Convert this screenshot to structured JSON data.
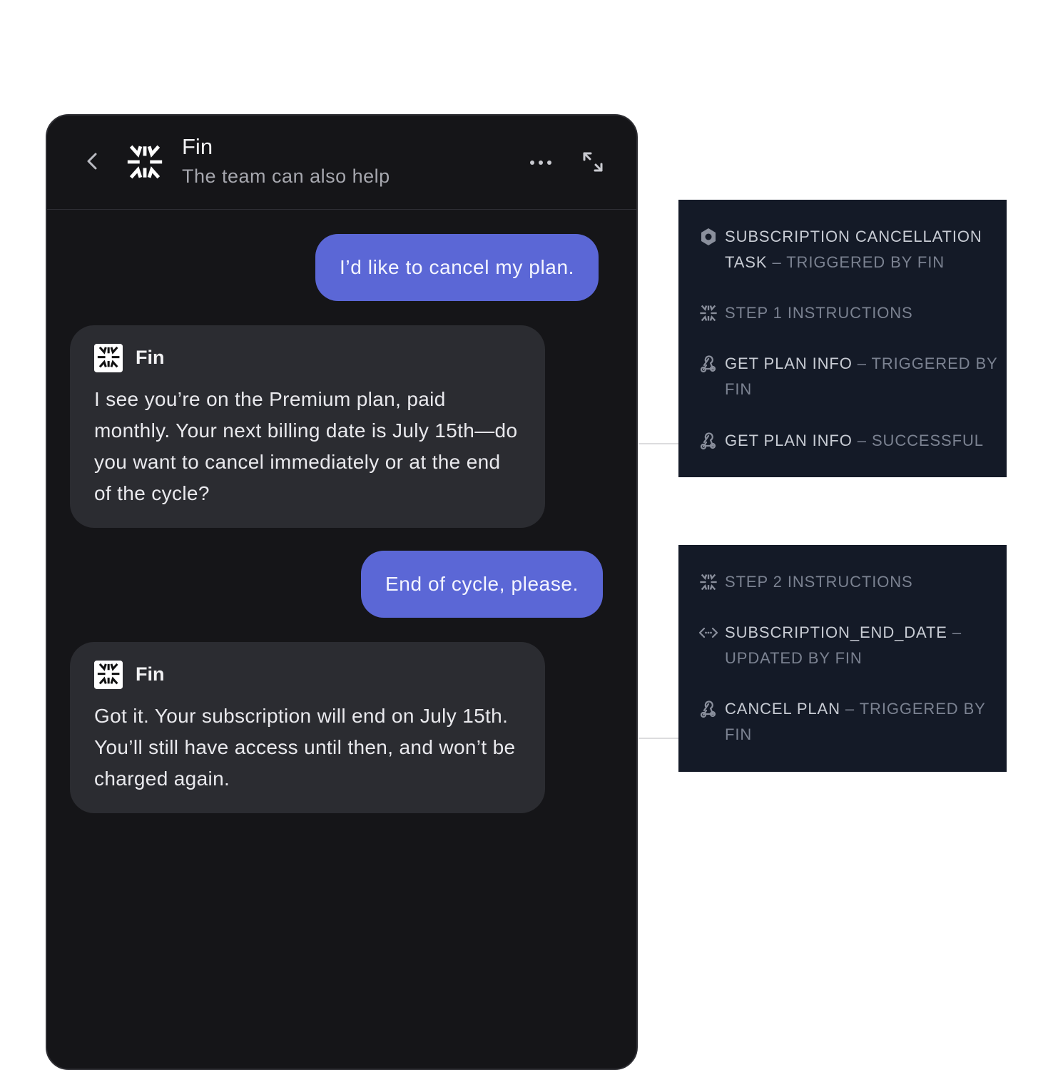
{
  "header": {
    "title": "Fin",
    "subtitle": "The team can also help",
    "back_icon": "chevron-left-icon",
    "more_icon": "more-horizontal-icon",
    "expand_icon": "expand-icon"
  },
  "messages": [
    {
      "role": "user",
      "text": "I’d like to cancel my plan."
    },
    {
      "role": "bot",
      "name": "Fin",
      "text": "I see you’re on the Premium plan, paid monthly. Your next billing date is July 15th—do you want to cancel immediately or at the end of the cycle?"
    },
    {
      "role": "user",
      "text": "End of cycle, please."
    },
    {
      "role": "bot",
      "name": "Fin",
      "text": "Got it. Your subscription will end on July 15th. You’ll still have access until then, and won’t be charged again."
    }
  ],
  "panels": [
    {
      "items": [
        {
          "icon": "hexagon-icon",
          "primary": "Subscription cancellation task",
          "secondary": "Triggered by Fin"
        },
        {
          "icon": "fin-logo-icon",
          "primary": "",
          "secondary": "Step 1 instructions"
        },
        {
          "icon": "webhook-icon",
          "primary": "Get plan info",
          "secondary": "Triggered by Fin"
        },
        {
          "icon": "webhook-icon",
          "primary": "Get plan info",
          "secondary": "Successful"
        }
      ]
    },
    {
      "items": [
        {
          "icon": "fin-logo-icon",
          "primary": "",
          "secondary": "Step 2 instructions"
        },
        {
          "icon": "code-icon",
          "primary": "subscription_end_date",
          "secondary": "Updated by Fin"
        },
        {
          "icon": "webhook-icon",
          "primary": "Cancel plan",
          "secondary": "Triggered by Fin"
        }
      ]
    }
  ],
  "colors": {
    "messenger_bg": "#151518",
    "user_bubble": "#5b67d6",
    "bot_bubble": "#2b2c31",
    "panel_bg": "#141a27"
  }
}
